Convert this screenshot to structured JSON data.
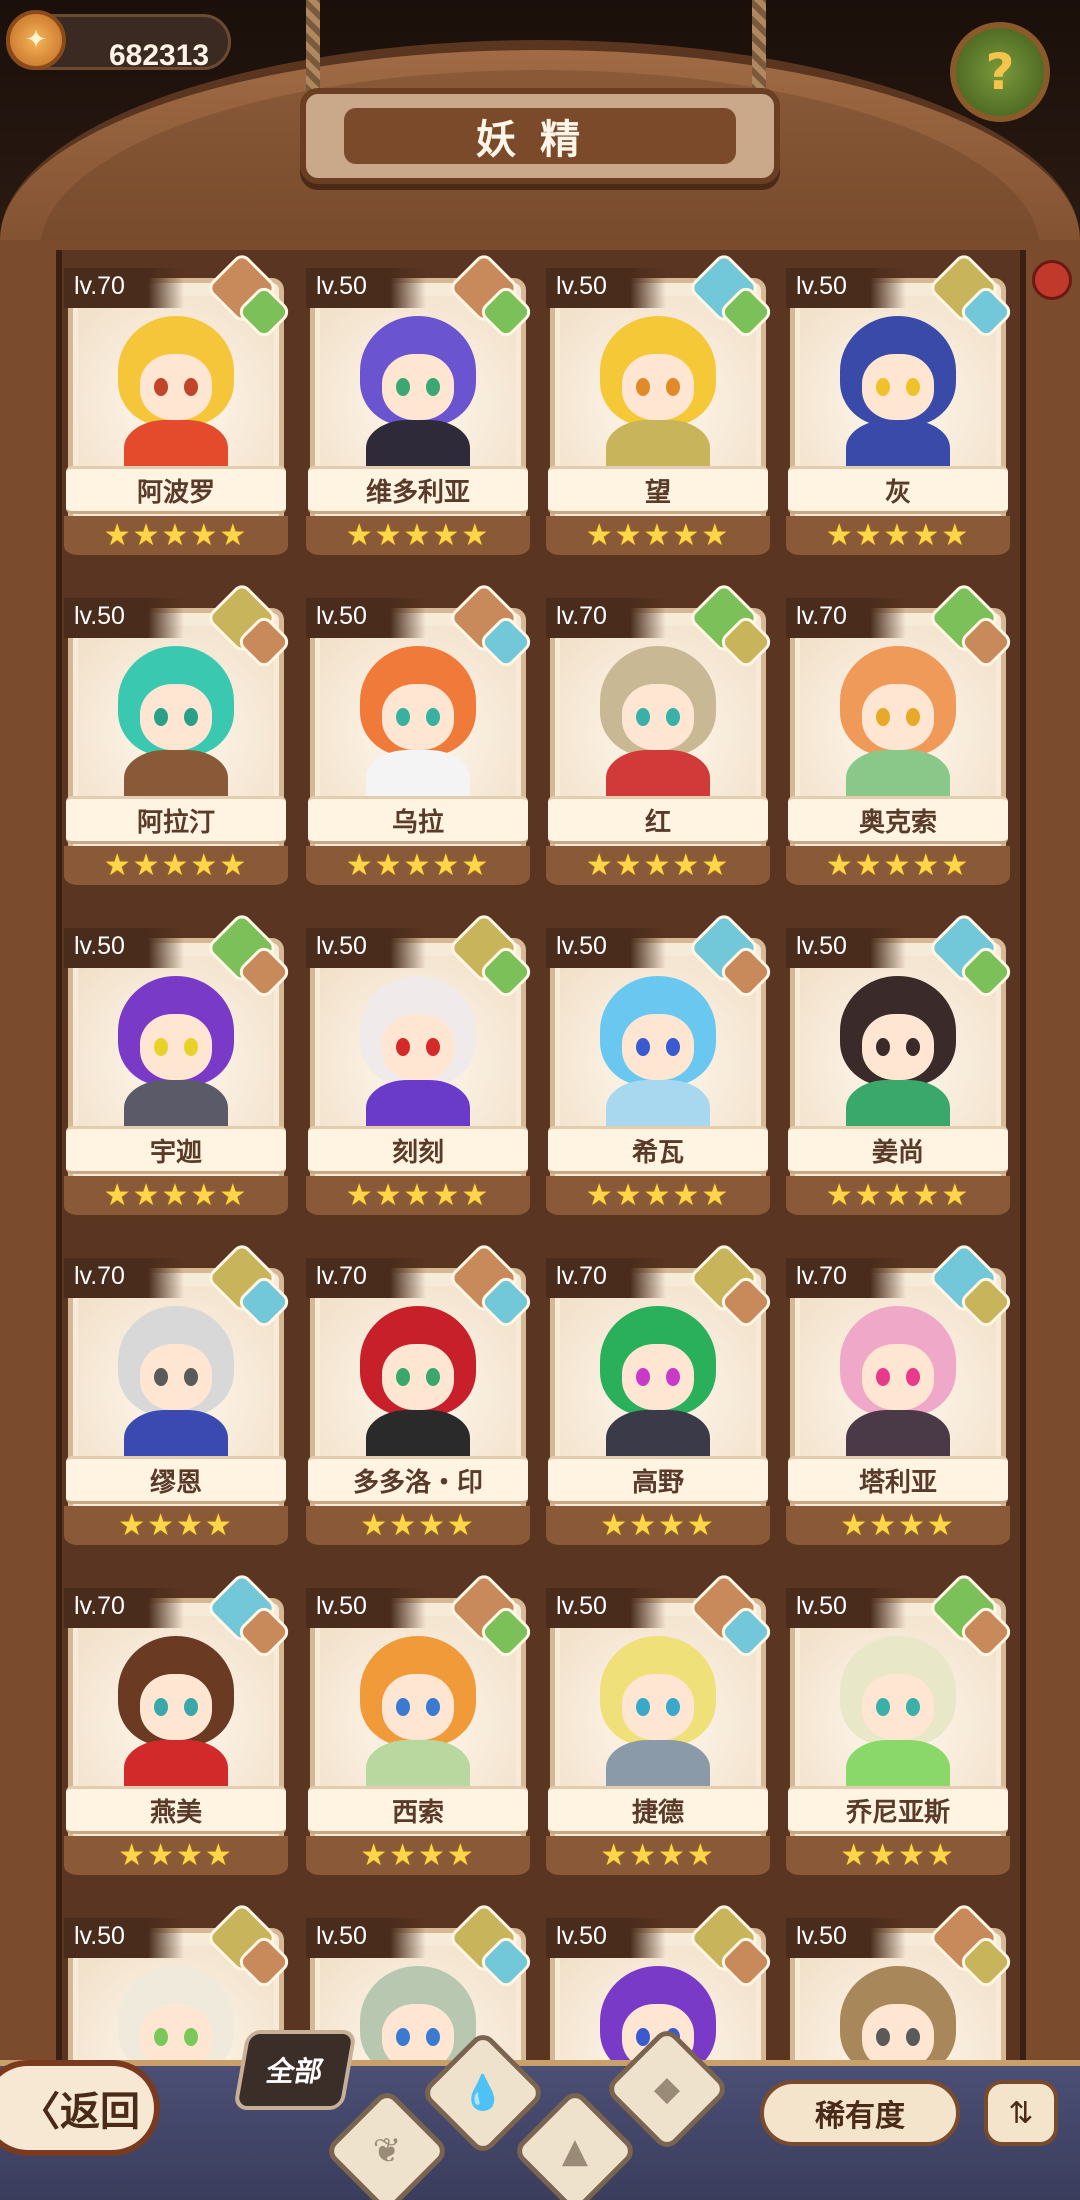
{
  "header": {
    "currency_value": "682313",
    "title": "妖精"
  },
  "colors": {
    "fire": "#c88a5a",
    "grass": "#7cc05a",
    "water": "#72c8d8",
    "earth": "#c8b45a"
  },
  "fairies": [
    {
      "level": "lv.70",
      "name": "阿波罗",
      "stars": "★★★★★",
      "elem_a": "fire",
      "elem_b": "grass",
      "hair": "#f5c53a",
      "eye": "#c0462a",
      "body": "#e34b2c"
    },
    {
      "level": "lv.50",
      "name": "维多利亚",
      "stars": "★★★★★",
      "elem_a": "fire",
      "elem_b": "grass",
      "hair": "#6a54d0",
      "eye": "#3aa870",
      "body": "#2e2a3a"
    },
    {
      "level": "lv.50",
      "name": "望",
      "stars": "★★★★★",
      "elem_a": "water",
      "elem_b": "grass",
      "hair": "#f5c838",
      "eye": "#e08a2a",
      "body": "#c8b45a"
    },
    {
      "level": "lv.50",
      "name": "灰",
      "stars": "★★★★★",
      "elem_a": "earth",
      "elem_b": "water",
      "hair": "#3a4aa8",
      "eye": "#f0c22a",
      "body": "#3a4aa8"
    },
    {
      "level": "lv.50",
      "name": "阿拉汀",
      "stars": "★★★★★",
      "elem_a": "earth",
      "elem_b": "fire",
      "hair": "#3ac8b0",
      "eye": "#2aa08a",
      "body": "#8a5a38"
    },
    {
      "level": "lv.50",
      "name": "乌拉",
      "stars": "★★★★★",
      "elem_a": "fire",
      "elem_b": "water",
      "hair": "#f07a3a",
      "eye": "#3ab0a0",
      "body": "#f4f4f4"
    },
    {
      "level": "lv.70",
      "name": "红",
      "stars": "★★★★★",
      "elem_a": "grass",
      "elem_b": "earth",
      "hair": "#c8b894",
      "eye": "#3ab0a8",
      "body": "#d23a3a"
    },
    {
      "level": "lv.70",
      "name": "奥克索",
      "stars": "★★★★★",
      "elem_a": "grass",
      "elem_b": "fire",
      "hair": "#f09a5a",
      "eye": "#e8a82a",
      "body": "#8ac88a"
    },
    {
      "level": "lv.50",
      "name": "宇迦",
      "stars": "★★★★★",
      "elem_a": "grass",
      "elem_b": "fire",
      "hair": "#7a3ac8",
      "eye": "#e8d22a",
      "body": "#5a5a68"
    },
    {
      "level": "lv.50",
      "name": "刻刻",
      "stars": "★★★★★",
      "elem_a": "earth",
      "elem_b": "grass",
      "hair": "#f0eaea",
      "eye": "#d42a2a",
      "body": "#6a3ac8"
    },
    {
      "level": "lv.50",
      "name": "希瓦",
      "stars": "★★★★★",
      "elem_a": "water",
      "elem_b": "fire",
      "hair": "#6ac8f0",
      "eye": "#3a5ad0",
      "body": "#a8d8f0"
    },
    {
      "level": "lv.50",
      "name": "姜尚",
      "stars": "★★★★★",
      "elem_a": "water",
      "elem_b": "grass",
      "hair": "#3a2a2a",
      "eye": "#3a2a2a",
      "body": "#3aa86a"
    },
    {
      "level": "lv.70",
      "name": "缪恩",
      "stars": "★★★★",
      "elem_a": "earth",
      "elem_b": "water",
      "hair": "#d8d8d8",
      "eye": "#5a5a5a",
      "body": "#3a4ab0"
    },
    {
      "level": "lv.70",
      "name": "多多洛・印",
      "stars": "★★★★",
      "elem_a": "fire",
      "elem_b": "water",
      "hair": "#c8202a",
      "eye": "#3aa86a",
      "body": "#2a2a2a"
    },
    {
      "level": "lv.70",
      "name": "高野",
      "stars": "★★★★",
      "elem_a": "earth",
      "elem_b": "fire",
      "hair": "#2ab05a",
      "eye": "#c83ac8",
      "body": "#3a3a48"
    },
    {
      "level": "lv.70",
      "name": "塔利亚",
      "stars": "★★★★",
      "elem_a": "water",
      "elem_b": "earth",
      "hair": "#f0a8c8",
      "eye": "#e83a8a",
      "body": "#4a3a48"
    },
    {
      "level": "lv.70",
      "name": "燕美",
      "stars": "★★★★",
      "elem_a": "water",
      "elem_b": "fire",
      "hair": "#6a3a22",
      "eye": "#3aa8a8",
      "body": "#d22a2a"
    },
    {
      "level": "lv.50",
      "name": "西索",
      "stars": "★★★★",
      "elem_a": "fire",
      "elem_b": "grass",
      "hair": "#f09a3a",
      "eye": "#3a7ad0",
      "body": "#b8d8a0"
    },
    {
      "level": "lv.50",
      "name": "捷德",
      "stars": "★★★★",
      "elem_a": "fire",
      "elem_b": "water",
      "hair": "#f0e07a",
      "eye": "#3aa8c8",
      "body": "#8a9aa8"
    },
    {
      "level": "lv.50",
      "name": "乔尼亚斯",
      "stars": "★★★★",
      "elem_a": "grass",
      "elem_b": "fire",
      "hair": "#e8e8c8",
      "eye": "#3ab0a8",
      "body": "#8ad86a"
    },
    {
      "level": "lv.50",
      "name": "",
      "stars": "",
      "elem_a": "earth",
      "elem_b": "fire",
      "hair": "#f0eadc",
      "eye": "#7ac85a",
      "body": "#f0eadc"
    },
    {
      "level": "lv.50",
      "name": "",
      "stars": "",
      "elem_a": "earth",
      "elem_b": "water",
      "hair": "#b8c8b0",
      "eye": "#3a7ad0",
      "body": "#d8d8d8"
    },
    {
      "level": "lv.50",
      "name": "",
      "stars": "",
      "elem_a": "earth",
      "elem_b": "fire",
      "hair": "#7a3ac8",
      "eye": "#3a5ad0",
      "body": "#6a3ac8"
    },
    {
      "level": "lv.50",
      "name": "",
      "stars": "",
      "elem_a": "fire",
      "elem_b": "earth",
      "hair": "#a8885a",
      "eye": "#5a5a5a",
      "body": "#8a6a48"
    }
  ],
  "footer": {
    "back_label": "〈返回",
    "filter_all_label": "全部",
    "sort_label": "稀有度",
    "order_icon": "sort-order-icon",
    "filter_icons": [
      "water-element-icon",
      "fire-element-icon",
      "grass-element-icon",
      "earth-element-icon"
    ]
  }
}
